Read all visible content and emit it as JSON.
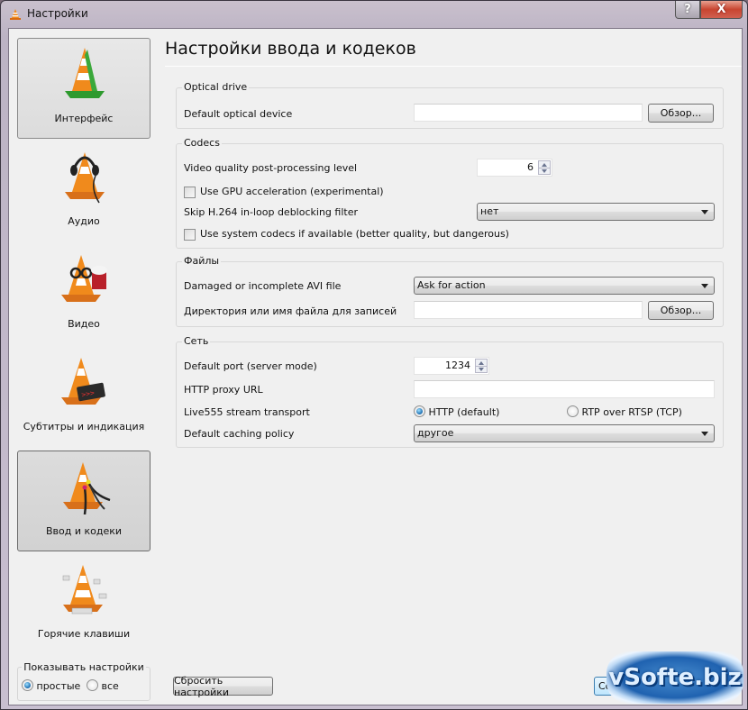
{
  "window": {
    "title": "Настройки",
    "help_label": "?",
    "close_label": "X"
  },
  "sidebar": {
    "categories": [
      {
        "label": "Интерфейс",
        "icon": "vlc-cone-green-icon",
        "selected": false
      },
      {
        "label": "Аудио",
        "icon": "vlc-cone-headphones-icon",
        "selected": false
      },
      {
        "label": "Видео",
        "icon": "vlc-cone-glasses-popcorn-icon",
        "selected": false
      },
      {
        "label": "Субтитры и индикация",
        "icon": "vlc-cone-subtitles-icon",
        "selected": false
      },
      {
        "label": "Ввод и кодеки",
        "icon": "vlc-cone-cables-icon",
        "selected": true
      },
      {
        "label": "Горячие клавиши",
        "icon": "vlc-cone-keys-icon",
        "selected": false
      }
    ],
    "show_settings": {
      "legend": "Показывать настройки",
      "options": [
        {
          "label": "простые",
          "checked": true
        },
        {
          "label": "все",
          "checked": false
        }
      ]
    }
  },
  "main": {
    "title": "Настройки ввода и кодеков",
    "groups": {
      "optical": {
        "title": "Optical drive",
        "default_device_label": "Default optical device",
        "default_device_value": "",
        "browse_label": "Обзор..."
      },
      "codecs": {
        "title": "Codecs",
        "pp_level_label": "Video quality post-processing level",
        "pp_level_value": "6",
        "gpu_label": "Use GPU acceleration (experimental)",
        "gpu_checked": false,
        "skip_h264_label": "Skip H.264 in-loop deblocking filter",
        "skip_h264_value": "нет",
        "system_codecs_label": "Use system codecs if available (better quality, but dangerous)",
        "system_codecs_checked": false
      },
      "files": {
        "title": "Файлы",
        "avi_label": "Damaged or incomplete AVI file",
        "avi_value": "Ask for action",
        "record_dir_label": "Директория или имя файла для записей",
        "record_dir_value": "",
        "browse_label": "Обзор..."
      },
      "network": {
        "title": "Сеть",
        "port_label": "Default port (server mode)",
        "port_value": "1234",
        "proxy_label": "HTTP proxy URL",
        "proxy_value": "",
        "transport_label": "Live555 stream transport",
        "transport_options": [
          {
            "label": "HTTP (default)",
            "checked": true
          },
          {
            "label": "RTP over RTSP (TCP)",
            "checked": false
          }
        ],
        "caching_label": "Default caching policy",
        "caching_value": "другое"
      }
    }
  },
  "footer": {
    "reset_label": "Сбросить настройки",
    "save_label": "Сохранить",
    "watermark": "vSofte.biz"
  }
}
